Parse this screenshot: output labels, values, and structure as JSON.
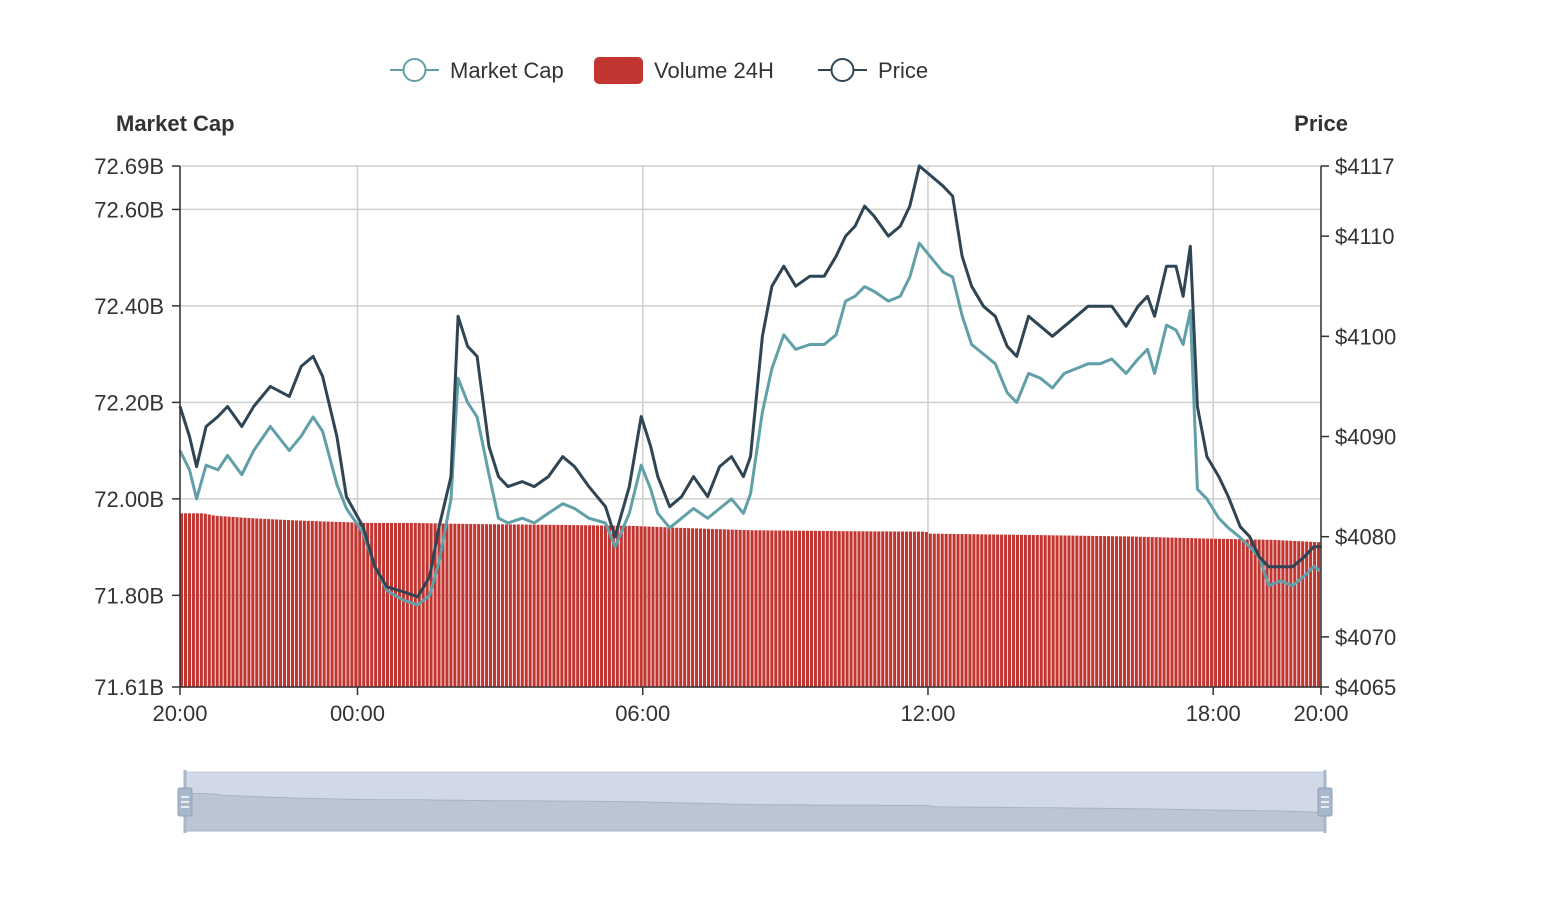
{
  "legend": {
    "items": [
      {
        "label": "Market Cap",
        "color": "#61a0a8",
        "icon": "circle-line-icon"
      },
      {
        "label": "Volume 24H",
        "color": "#c23531",
        "icon": "rounded-rect-icon"
      },
      {
        "label": "Price",
        "color": "#2f4554",
        "icon": "circle-line-icon"
      }
    ]
  },
  "chart_data": {
    "type": "line",
    "left_axis": {
      "title": "Market Cap",
      "min": 71.61,
      "max": 72.69,
      "ticks": [
        {
          "value": 72.69,
          "label": "72.69B"
        },
        {
          "value": 72.6,
          "label": "72.60B"
        },
        {
          "value": 72.4,
          "label": "72.40B"
        },
        {
          "value": 72.2,
          "label": "72.20B"
        },
        {
          "value": 72.0,
          "label": "72.00B"
        },
        {
          "value": 71.8,
          "label": "71.80B"
        },
        {
          "value": 71.61,
          "label": "71.61B"
        }
      ]
    },
    "right_axis": {
      "title": "Price",
      "min": 4065,
      "max": 4117,
      "ticks": [
        {
          "value": 4117,
          "label": "$4117"
        },
        {
          "value": 4110,
          "label": "$4110"
        },
        {
          "value": 4100,
          "label": "$4100"
        },
        {
          "value": 4090,
          "label": "$4090"
        },
        {
          "value": 4080,
          "label": "$4080"
        },
        {
          "value": 4070,
          "label": "$4070"
        },
        {
          "value": 4065,
          "label": "$4065"
        }
      ]
    },
    "x_axis": {
      "min": 0,
      "max": 24,
      "ticks": [
        {
          "value": 0,
          "label": "20:00"
        },
        {
          "value": 3.733,
          "label": "00:00"
        },
        {
          "value": 9.733,
          "label": "06:00"
        },
        {
          "value": 15.733,
          "label": "12:00"
        },
        {
          "value": 21.733,
          "label": "18:00"
        },
        {
          "value": 24,
          "label": "20:00"
        }
      ],
      "unit": "hours since 20:00"
    },
    "grid": true,
    "series": [
      {
        "name": "Market Cap",
        "axis": "left",
        "color": "#61a0a8",
        "points": [
          [
            0,
            72.1
          ],
          [
            0.2,
            72.06
          ],
          [
            0.35,
            72.0
          ],
          [
            0.55,
            72.07
          ],
          [
            0.8,
            72.06
          ],
          [
            1.0,
            72.09
          ],
          [
            1.3,
            72.05
          ],
          [
            1.55,
            72.1
          ],
          [
            1.9,
            72.15
          ],
          [
            2.3,
            72.1
          ],
          [
            2.55,
            72.13
          ],
          [
            2.8,
            72.17
          ],
          [
            3.0,
            72.14
          ],
          [
            3.3,
            72.03
          ],
          [
            3.5,
            71.98
          ],
          [
            3.85,
            71.93
          ],
          [
            4.1,
            71.86
          ],
          [
            4.35,
            71.81
          ],
          [
            4.7,
            71.79
          ],
          [
            5.0,
            71.78
          ],
          [
            5.25,
            71.8
          ],
          [
            5.45,
            71.87
          ],
          [
            5.7,
            72.0
          ],
          [
            5.85,
            72.25
          ],
          [
            6.05,
            72.2
          ],
          [
            6.25,
            72.17
          ],
          [
            6.5,
            72.05
          ],
          [
            6.7,
            71.96
          ],
          [
            6.9,
            71.95
          ],
          [
            7.2,
            71.96
          ],
          [
            7.45,
            71.95
          ],
          [
            7.75,
            71.97
          ],
          [
            8.05,
            71.99
          ],
          [
            8.3,
            71.98
          ],
          [
            8.6,
            71.96
          ],
          [
            8.95,
            71.95
          ],
          [
            9.15,
            71.9
          ],
          [
            9.45,
            71.97
          ],
          [
            9.7,
            72.07
          ],
          [
            9.9,
            72.02
          ],
          [
            10.05,
            71.97
          ],
          [
            10.3,
            71.94
          ],
          [
            10.55,
            71.96
          ],
          [
            10.8,
            71.98
          ],
          [
            11.1,
            71.96
          ],
          [
            11.35,
            71.98
          ],
          [
            11.6,
            72.0
          ],
          [
            11.85,
            71.97
          ],
          [
            12.0,
            72.01
          ],
          [
            12.25,
            72.18
          ],
          [
            12.45,
            72.27
          ],
          [
            12.7,
            72.34
          ],
          [
            12.95,
            72.31
          ],
          [
            13.25,
            72.32
          ],
          [
            13.55,
            72.32
          ],
          [
            13.8,
            72.34
          ],
          [
            14.0,
            72.41
          ],
          [
            14.2,
            72.42
          ],
          [
            14.4,
            72.44
          ],
          [
            14.6,
            72.43
          ],
          [
            14.9,
            72.41
          ],
          [
            15.15,
            72.42
          ],
          [
            15.35,
            72.46
          ],
          [
            15.55,
            72.53
          ],
          [
            15.8,
            72.5
          ],
          [
            16.05,
            72.47
          ],
          [
            16.25,
            72.46
          ],
          [
            16.45,
            72.38
          ],
          [
            16.65,
            72.32
          ],
          [
            16.9,
            72.3
          ],
          [
            17.15,
            72.28
          ],
          [
            17.4,
            72.22
          ],
          [
            17.6,
            72.2
          ],
          [
            17.85,
            72.26
          ],
          [
            18.1,
            72.25
          ],
          [
            18.35,
            72.23
          ],
          [
            18.6,
            72.26
          ],
          [
            18.85,
            72.27
          ],
          [
            19.1,
            72.28
          ],
          [
            19.35,
            72.28
          ],
          [
            19.6,
            72.29
          ],
          [
            19.9,
            72.26
          ],
          [
            20.15,
            72.29
          ],
          [
            20.35,
            72.31
          ],
          [
            20.5,
            72.26
          ],
          [
            20.75,
            72.36
          ],
          [
            20.95,
            72.35
          ],
          [
            21.1,
            72.32
          ],
          [
            21.25,
            72.39
          ],
          [
            21.4,
            72.02
          ],
          [
            21.6,
            72.0
          ],
          [
            21.85,
            71.96
          ],
          [
            22.05,
            71.94
          ],
          [
            22.3,
            71.92
          ],
          [
            22.5,
            71.9
          ],
          [
            22.7,
            71.88
          ],
          [
            22.9,
            71.82
          ],
          [
            23.15,
            71.83
          ],
          [
            23.4,
            71.82
          ],
          [
            23.65,
            71.84
          ],
          [
            23.85,
            71.86
          ],
          [
            24.0,
            71.85
          ]
        ]
      },
      {
        "name": "Price",
        "axis": "right",
        "color": "#2f4554",
        "points": [
          [
            0,
            4093
          ],
          [
            0.2,
            4090
          ],
          [
            0.35,
            4087
          ],
          [
            0.55,
            4091
          ],
          [
            0.8,
            4092
          ],
          [
            1.0,
            4093
          ],
          [
            1.3,
            4091
          ],
          [
            1.55,
            4093
          ],
          [
            1.9,
            4095
          ],
          [
            2.3,
            4094
          ],
          [
            2.55,
            4097
          ],
          [
            2.8,
            4098
          ],
          [
            3.0,
            4096
          ],
          [
            3.3,
            4090
          ],
          [
            3.5,
            4084
          ],
          [
            3.85,
            4081
          ],
          [
            4.1,
            4077
          ],
          [
            4.35,
            4075
          ],
          [
            4.7,
            4074.5
          ],
          [
            5.0,
            4074
          ],
          [
            5.25,
            4076
          ],
          [
            5.45,
            4081
          ],
          [
            5.7,
            4086
          ],
          [
            5.85,
            4102
          ],
          [
            6.05,
            4099
          ],
          [
            6.25,
            4098
          ],
          [
            6.5,
            4089
          ],
          [
            6.7,
            4086
          ],
          [
            6.9,
            4085
          ],
          [
            7.2,
            4085.5
          ],
          [
            7.45,
            4085
          ],
          [
            7.75,
            4086
          ],
          [
            8.05,
            4088
          ],
          [
            8.3,
            4087
          ],
          [
            8.6,
            4085
          ],
          [
            8.95,
            4083
          ],
          [
            9.15,
            4080
          ],
          [
            9.45,
            4085
          ],
          [
            9.7,
            4092
          ],
          [
            9.9,
            4089
          ],
          [
            10.05,
            4086
          ],
          [
            10.3,
            4083
          ],
          [
            10.55,
            4084
          ],
          [
            10.8,
            4086
          ],
          [
            11.1,
            4084
          ],
          [
            11.35,
            4087
          ],
          [
            11.6,
            4088
          ],
          [
            11.85,
            4086
          ],
          [
            12.0,
            4088
          ],
          [
            12.25,
            4100
          ],
          [
            12.45,
            4105
          ],
          [
            12.7,
            4107
          ],
          [
            12.95,
            4105
          ],
          [
            13.25,
            4106
          ],
          [
            13.55,
            4106
          ],
          [
            13.8,
            4108
          ],
          [
            14.0,
            4110
          ],
          [
            14.2,
            4111
          ],
          [
            14.4,
            4113
          ],
          [
            14.6,
            4112
          ],
          [
            14.9,
            4110
          ],
          [
            15.15,
            4111
          ],
          [
            15.35,
            4113
          ],
          [
            15.55,
            4117
          ],
          [
            15.8,
            4116
          ],
          [
            16.05,
            4115
          ],
          [
            16.25,
            4114
          ],
          [
            16.45,
            4108
          ],
          [
            16.65,
            4105
          ],
          [
            16.9,
            4103
          ],
          [
            17.15,
            4102
          ],
          [
            17.4,
            4099
          ],
          [
            17.6,
            4098
          ],
          [
            17.85,
            4102
          ],
          [
            18.1,
            4101
          ],
          [
            18.35,
            4100
          ],
          [
            18.6,
            4101
          ],
          [
            18.85,
            4102
          ],
          [
            19.1,
            4103
          ],
          [
            19.35,
            4103
          ],
          [
            19.6,
            4103
          ],
          [
            19.9,
            4101
          ],
          [
            20.15,
            4103
          ],
          [
            20.35,
            4104
          ],
          [
            20.5,
            4102
          ],
          [
            20.75,
            4107
          ],
          [
            20.95,
            4107
          ],
          [
            21.1,
            4104
          ],
          [
            21.25,
            4109
          ],
          [
            21.4,
            4093
          ],
          [
            21.6,
            4088
          ],
          [
            21.85,
            4086
          ],
          [
            22.05,
            4084
          ],
          [
            22.3,
            4081
          ],
          [
            22.5,
            4080
          ],
          [
            22.7,
            4078
          ],
          [
            22.9,
            4077
          ],
          [
            23.15,
            4077
          ],
          [
            23.4,
            4077
          ],
          [
            23.65,
            4078
          ],
          [
            23.85,
            4079
          ],
          [
            24.0,
            4079
          ]
        ]
      },
      {
        "name": "Volume 24H",
        "axis": "left",
        "color": "#c23531",
        "type": "bar",
        "points": [
          [
            0,
            71.97
          ],
          [
            0.5,
            71.97
          ],
          [
            0.75,
            71.965
          ],
          [
            1.5,
            71.96
          ],
          [
            2.5,
            71.955
          ],
          [
            4.0,
            71.95
          ],
          [
            5.0,
            71.95
          ],
          [
            6.0,
            71.948
          ],
          [
            8.0,
            71.946
          ],
          [
            9.5,
            71.944
          ],
          [
            10.5,
            71.94
          ],
          [
            12.0,
            71.935
          ],
          [
            14.0,
            71.933
          ],
          [
            15.7,
            71.932
          ],
          [
            15.75,
            71.928
          ],
          [
            18.0,
            71.925
          ],
          [
            20.0,
            71.922
          ],
          [
            21.5,
            71.918
          ],
          [
            23.0,
            71.915
          ],
          [
            24.0,
            71.91
          ]
        ]
      }
    ]
  },
  "zoom_slider": {
    "start_percent": 0,
    "end_percent": 100
  }
}
